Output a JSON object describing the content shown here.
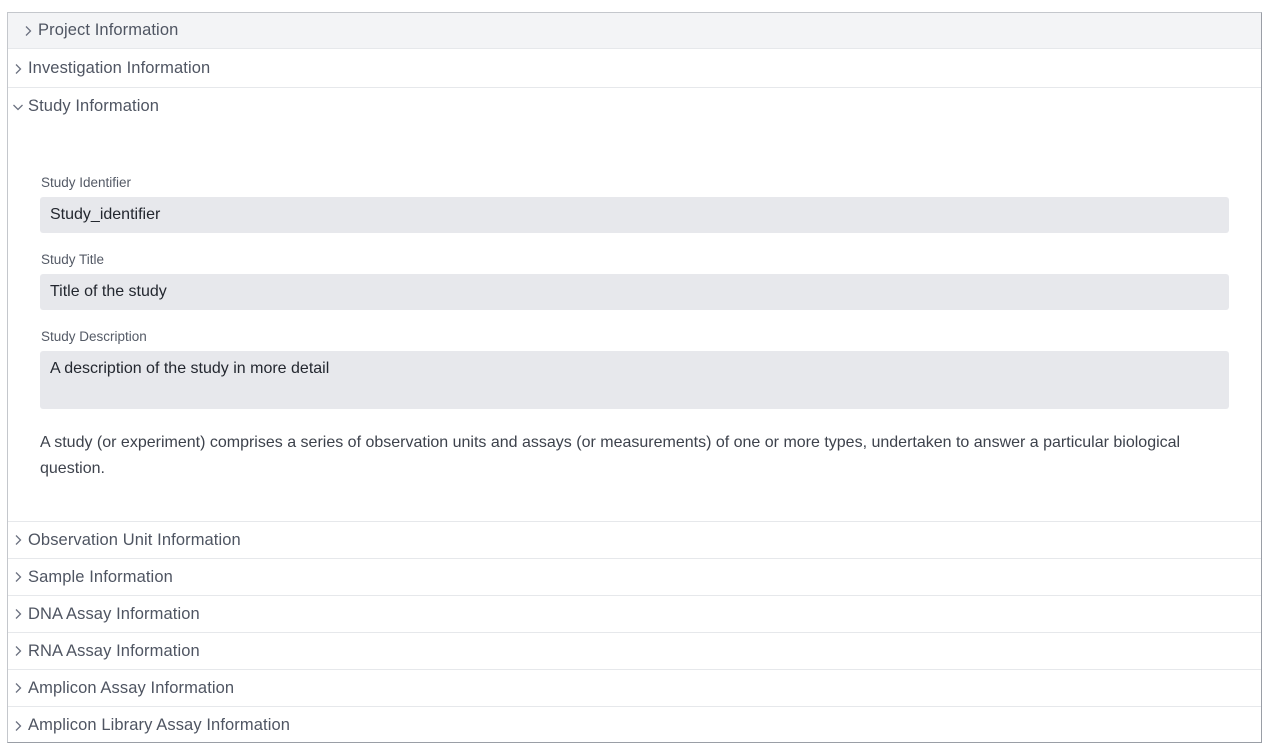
{
  "sections": [
    {
      "label": "Project Information",
      "expanded": false,
      "hovered": true
    },
    {
      "label": "Investigation Information",
      "expanded": false
    },
    {
      "label": "Study Information",
      "expanded": true
    },
    {
      "label": "Observation Unit Information",
      "expanded": false
    },
    {
      "label": "Sample Information",
      "expanded": false
    },
    {
      "label": "DNA Assay Information",
      "expanded": false
    },
    {
      "label": "RNA Assay Information",
      "expanded": false
    },
    {
      "label": "Amplicon Assay Information",
      "expanded": false
    },
    {
      "label": "Amplicon Library Assay Information",
      "expanded": false
    }
  ],
  "study": {
    "identifier_label": "Study Identifier",
    "identifier_value": "Study_identifier",
    "title_label": "Study Title",
    "title_value": "Title of the study",
    "description_label": "Study Description",
    "description_value": "A description of the study in more detail",
    "help_text": "A study (or experiment) comprises a series of observation units and assays (or measurements) of one or more types, undertaken to answer a particular biological question."
  },
  "icons": {
    "collapsed": "chevron-right-icon",
    "expanded": "chevron-down-icon"
  },
  "colors": {
    "input_background": "#e7e8ec",
    "hover_background": "#f3f4f6",
    "divider": "#e6e8eb"
  }
}
